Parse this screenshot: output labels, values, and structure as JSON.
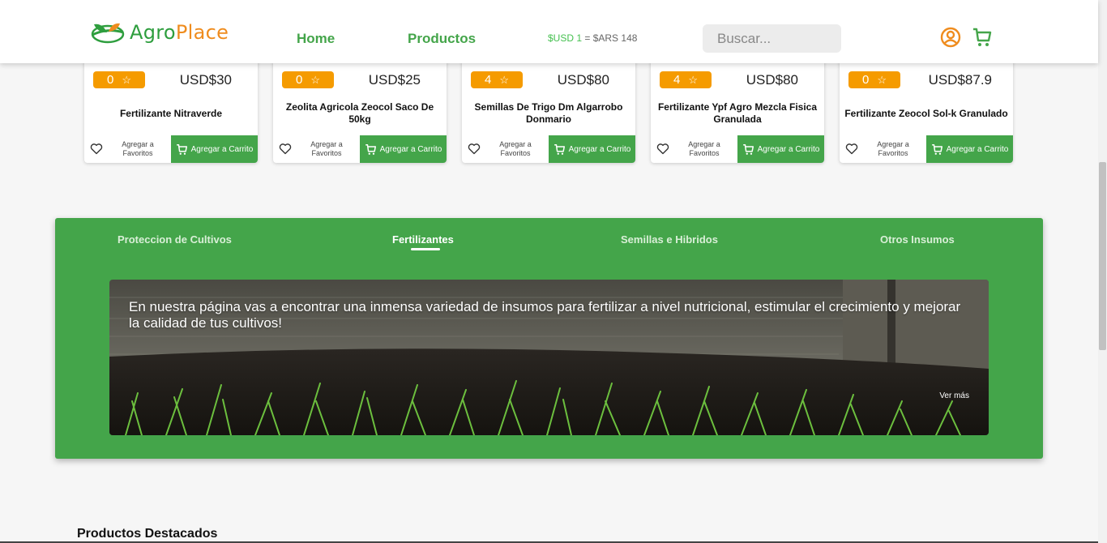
{
  "header": {
    "logo_agro": "Agro",
    "logo_place": "Place",
    "nav_home": "Home",
    "nav_products": "Productos",
    "rate_usd": "$USD 1",
    "rate_rest": " = $ARS 148",
    "search_placeholder": "Buscar..."
  },
  "products": [
    {
      "rating": "0",
      "price": "USD$30",
      "name": "Fertilizante Nitraverde",
      "fav_label": "Agregar a Favoritos",
      "cart_label": "Agregar a Carrito"
    },
    {
      "rating": "0",
      "price": "USD$25",
      "name": "Zeolita Agricola Zeocol Saco De 50kg",
      "fav_label": "Agregar a Favoritos",
      "cart_label": "Agregar a Carrito"
    },
    {
      "rating": "4",
      "price": "USD$80",
      "name": "Semillas De Trigo Dm Algarrobo Donmario",
      "fav_label": "Agregar a Favoritos",
      "cart_label": "Agregar a Carrito"
    },
    {
      "rating": "4",
      "price": "USD$80",
      "name": "Fertilizante Ypf Agro Mezcla Fisica Granulada",
      "fav_label": "Agregar a Favoritos",
      "cart_label": "Agregar a Carrito"
    },
    {
      "rating": "0",
      "price": "USD$87.9",
      "name": "Fertilizante Zeocol Sol-k Granulado",
      "fav_label": "Agregar a Favoritos",
      "cart_label": "Agregar a Carrito"
    }
  ],
  "categories": {
    "tabs": [
      "Proteccion de Cultivos",
      "Fertilizantes",
      "Semillas e Hibridos",
      "Otros Insumos"
    ],
    "active_tab": "Fertilizantes",
    "banner_text": "En nuestra página vas a encontrar una inmensa variedad de insumos para fertilizar a nivel nutricional, estimular el crecimiento y mejorar la calidad de tus cultivos!",
    "ver_mas": "Ver más"
  },
  "featured_title": "Productos Destacados",
  "colors": {
    "brand_green": "#44a54a",
    "brand_orange": "#ef8c1e",
    "badge_orange": "#f59b00"
  }
}
